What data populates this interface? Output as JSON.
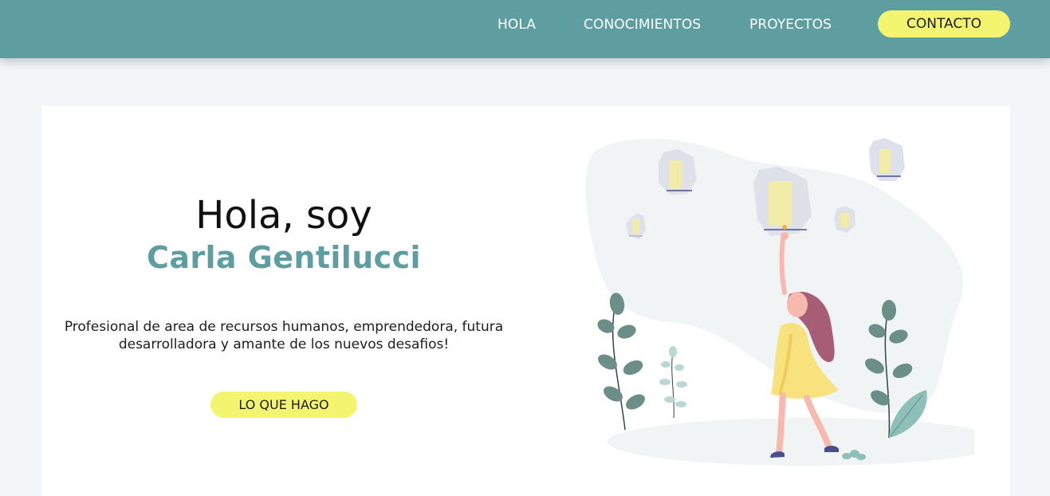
{
  "nav": {
    "items": [
      {
        "label": "HOLA"
      },
      {
        "label": "CONOCIMIENTOS"
      },
      {
        "label": "PROYECTOS"
      }
    ],
    "contact_label": "CONTACTO"
  },
  "hero": {
    "greeting": "Hola, soy",
    "name": "Carla Gentilucci",
    "description_line1": "Profesional de area de recursos humanos, emprendedora, futura",
    "description_line2": "desarrolladora y amante de los nuevos desafios!",
    "cta_label": "LO QUE HAGO",
    "illustration_icon": "woman-with-sky-lanterns-illustration"
  },
  "colors": {
    "navbar": "#5f9ea0",
    "accent_name": "#5f9ea0",
    "button_yellow": "#f3f571",
    "page_background": "#f4f5f9",
    "card_background": "#ffffff"
  }
}
